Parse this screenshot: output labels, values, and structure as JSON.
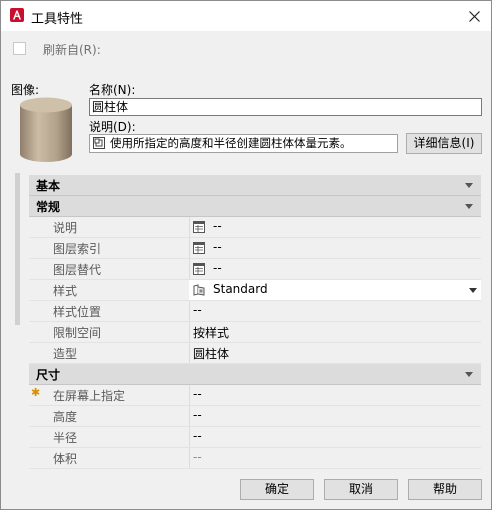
{
  "titlebar": {
    "title": "工具特性",
    "close_icon": "close-icon"
  },
  "refresh": {
    "label": "刷新自(R):",
    "checked": false
  },
  "image": {
    "label": "图像:"
  },
  "name": {
    "label": "名称(N):",
    "value": "圆柱体"
  },
  "description": {
    "label": "说明(D):",
    "value": "使用所指定的高度和半径创建圆柱体体量元素。",
    "details_button": "详细信息(I)"
  },
  "sections": {
    "basic": {
      "title": "基本"
    },
    "general": {
      "title": "常规",
      "rows": [
        {
          "name": "说明",
          "value": "--"
        },
        {
          "name": "图层索引",
          "value": "--"
        },
        {
          "name": "图层替代",
          "value": "--"
        },
        {
          "name": "样式",
          "value": "Standard"
        },
        {
          "name": "样式位置",
          "value": "--"
        },
        {
          "name": "限制空间",
          "value": "按样式"
        },
        {
          "name": "造型",
          "value": "圆柱体"
        }
      ]
    },
    "dimensions": {
      "title": "尺寸",
      "rows": [
        {
          "name": "在屏幕上指定",
          "value": "--"
        },
        {
          "name": "高度",
          "value": "--"
        },
        {
          "name": "半径",
          "value": "--"
        },
        {
          "name": "体积",
          "value": "--"
        }
      ]
    }
  },
  "buttons": {
    "ok": "确定",
    "cancel": "取消",
    "help": "帮助"
  },
  "colors": {
    "app_icon_red": "#c8102e",
    "cylinder": "#c3b29c"
  }
}
